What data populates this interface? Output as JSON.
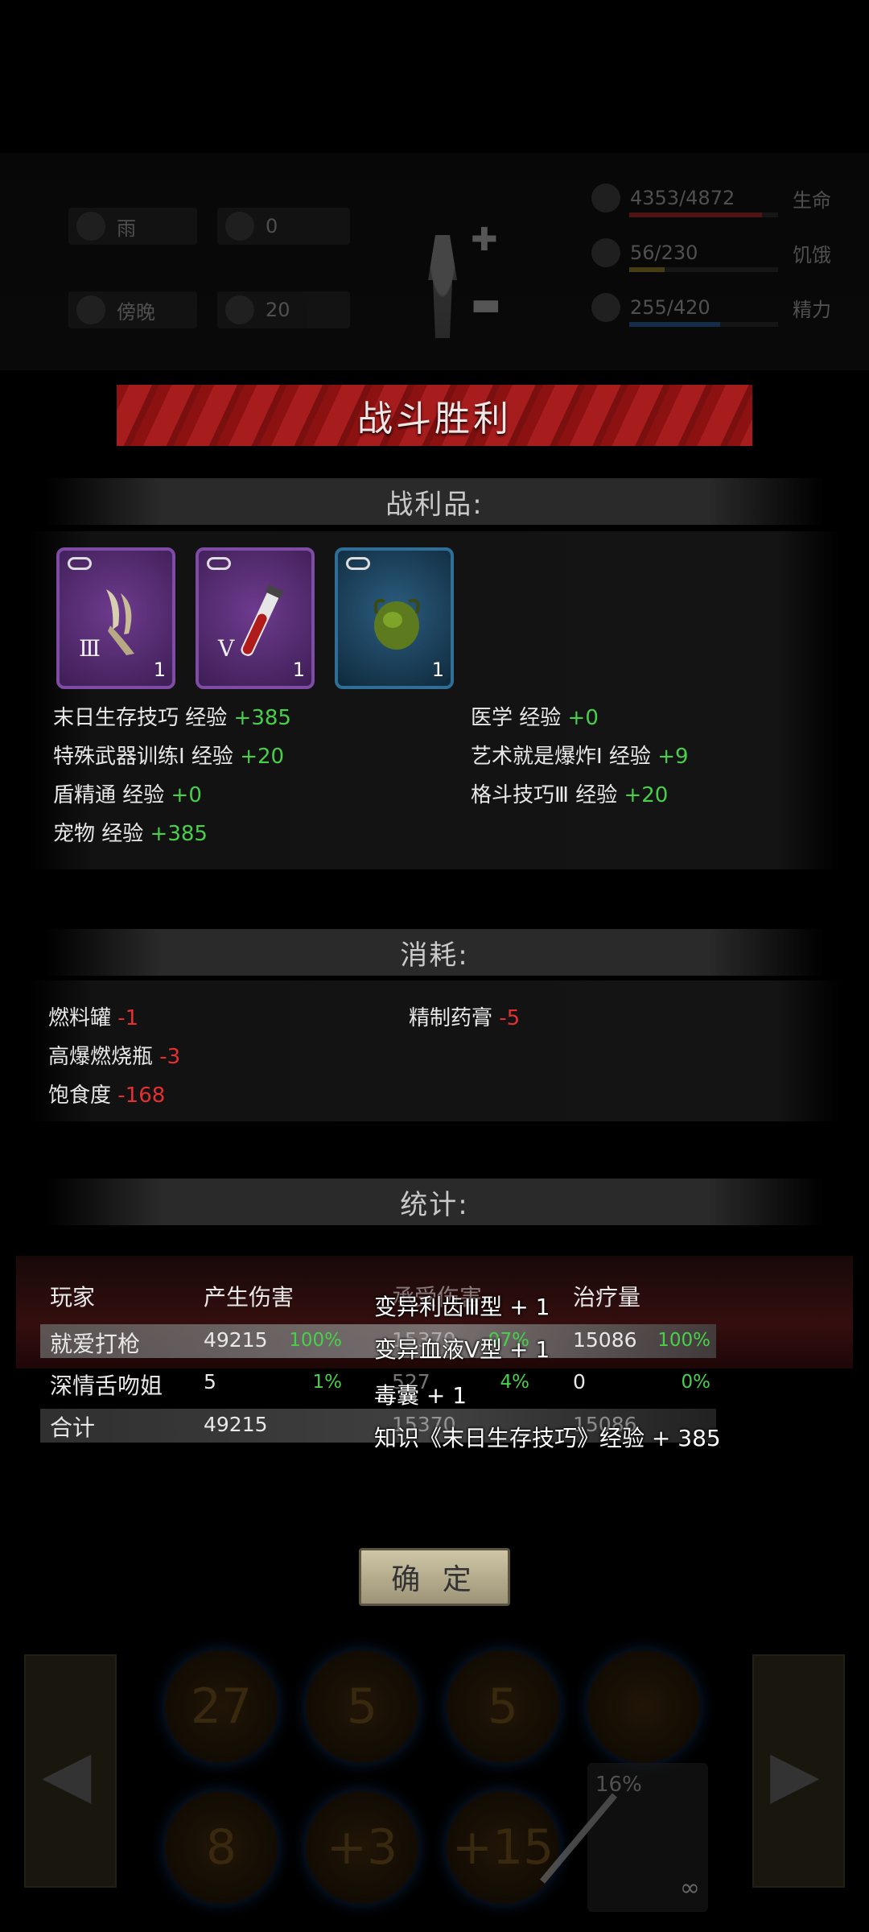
{
  "hud": {
    "weather": "雨",
    "radiation": "0",
    "time_of_day": "傍晚",
    "temperature": "20",
    "health": {
      "value": "4353/4872",
      "label": "生命",
      "color": "#8a1e1e",
      "fill": 0.89
    },
    "hunger": {
      "value": "56/230",
      "label": "饥饿",
      "color": "#7a6a1e",
      "fill": 0.24
    },
    "energy": {
      "value": "255/420",
      "label": "精力",
      "color": "#1e4a7a",
      "fill": 0.61
    }
  },
  "banner_title": "战斗胜利",
  "loot": {
    "title": "战利品:",
    "items": [
      {
        "icon": "claw-item-icon",
        "tier": "Ⅲ",
        "qty": "1",
        "rarity": "purple"
      },
      {
        "icon": "blood-vial-item-icon",
        "tier": "Ⅴ",
        "qty": "1",
        "rarity": "purple"
      },
      {
        "icon": "poison-sac-item-icon",
        "tier": "",
        "qty": "1",
        "rarity": "blue"
      }
    ],
    "exp": [
      {
        "name": "末日生存技巧 经验",
        "delta": "+385"
      },
      {
        "name": "医学 经验",
        "delta": "+0"
      },
      {
        "name": "特殊武器训练Ⅰ 经验",
        "delta": "+20"
      },
      {
        "name": "艺术就是爆炸Ⅰ 经验",
        "delta": "+9"
      },
      {
        "name": "盾精通 经验",
        "delta": "+0"
      },
      {
        "name": "格斗技巧Ⅲ 经验",
        "delta": "+20"
      },
      {
        "name": "宠物 经验",
        "delta": "+385"
      }
    ]
  },
  "consume": {
    "title": "消耗:",
    "items": [
      {
        "name": "燃料罐",
        "delta": "-1"
      },
      {
        "name": "精制药膏",
        "delta": "-5"
      },
      {
        "name": "高爆燃烧瓶",
        "delta": "-3"
      },
      {
        "name": "饱食度",
        "delta": "-168"
      }
    ]
  },
  "stats": {
    "title": "统计:",
    "headers": [
      "玩家",
      "产生伤害",
      "承受伤害",
      "治疗量"
    ],
    "rows": [
      {
        "player": "就爱打枪",
        "dealt": "49215",
        "dealt_pct": "100%",
        "taken": "15370",
        "taken_pct": "97%",
        "heal": "15086",
        "heal_pct": "100%"
      },
      {
        "player": "深情舌吻姐",
        "dealt": "5",
        "dealt_pct": "1%",
        "taken": "527",
        "taken_pct": "4%",
        "heal": "0",
        "heal_pct": "0%"
      }
    ],
    "total": {
      "label": "合计",
      "dealt": "49215",
      "taken": "15370",
      "heal": "15086"
    }
  },
  "toasts": [
    "变异利齿Ⅲ型 + 1",
    "变异血液Ⅴ型 + 1",
    "毒囊 + 1",
    "知识《末日生存技巧》经验 + 385"
  ],
  "confirm_label": "确 定",
  "bottom": {
    "skills_top": [
      "27",
      "5",
      "5",
      ""
    ],
    "skills_bottom": [
      "8",
      "+3",
      "+15"
    ],
    "weapon_pct": "16%",
    "weapon_ammo": "∞"
  }
}
